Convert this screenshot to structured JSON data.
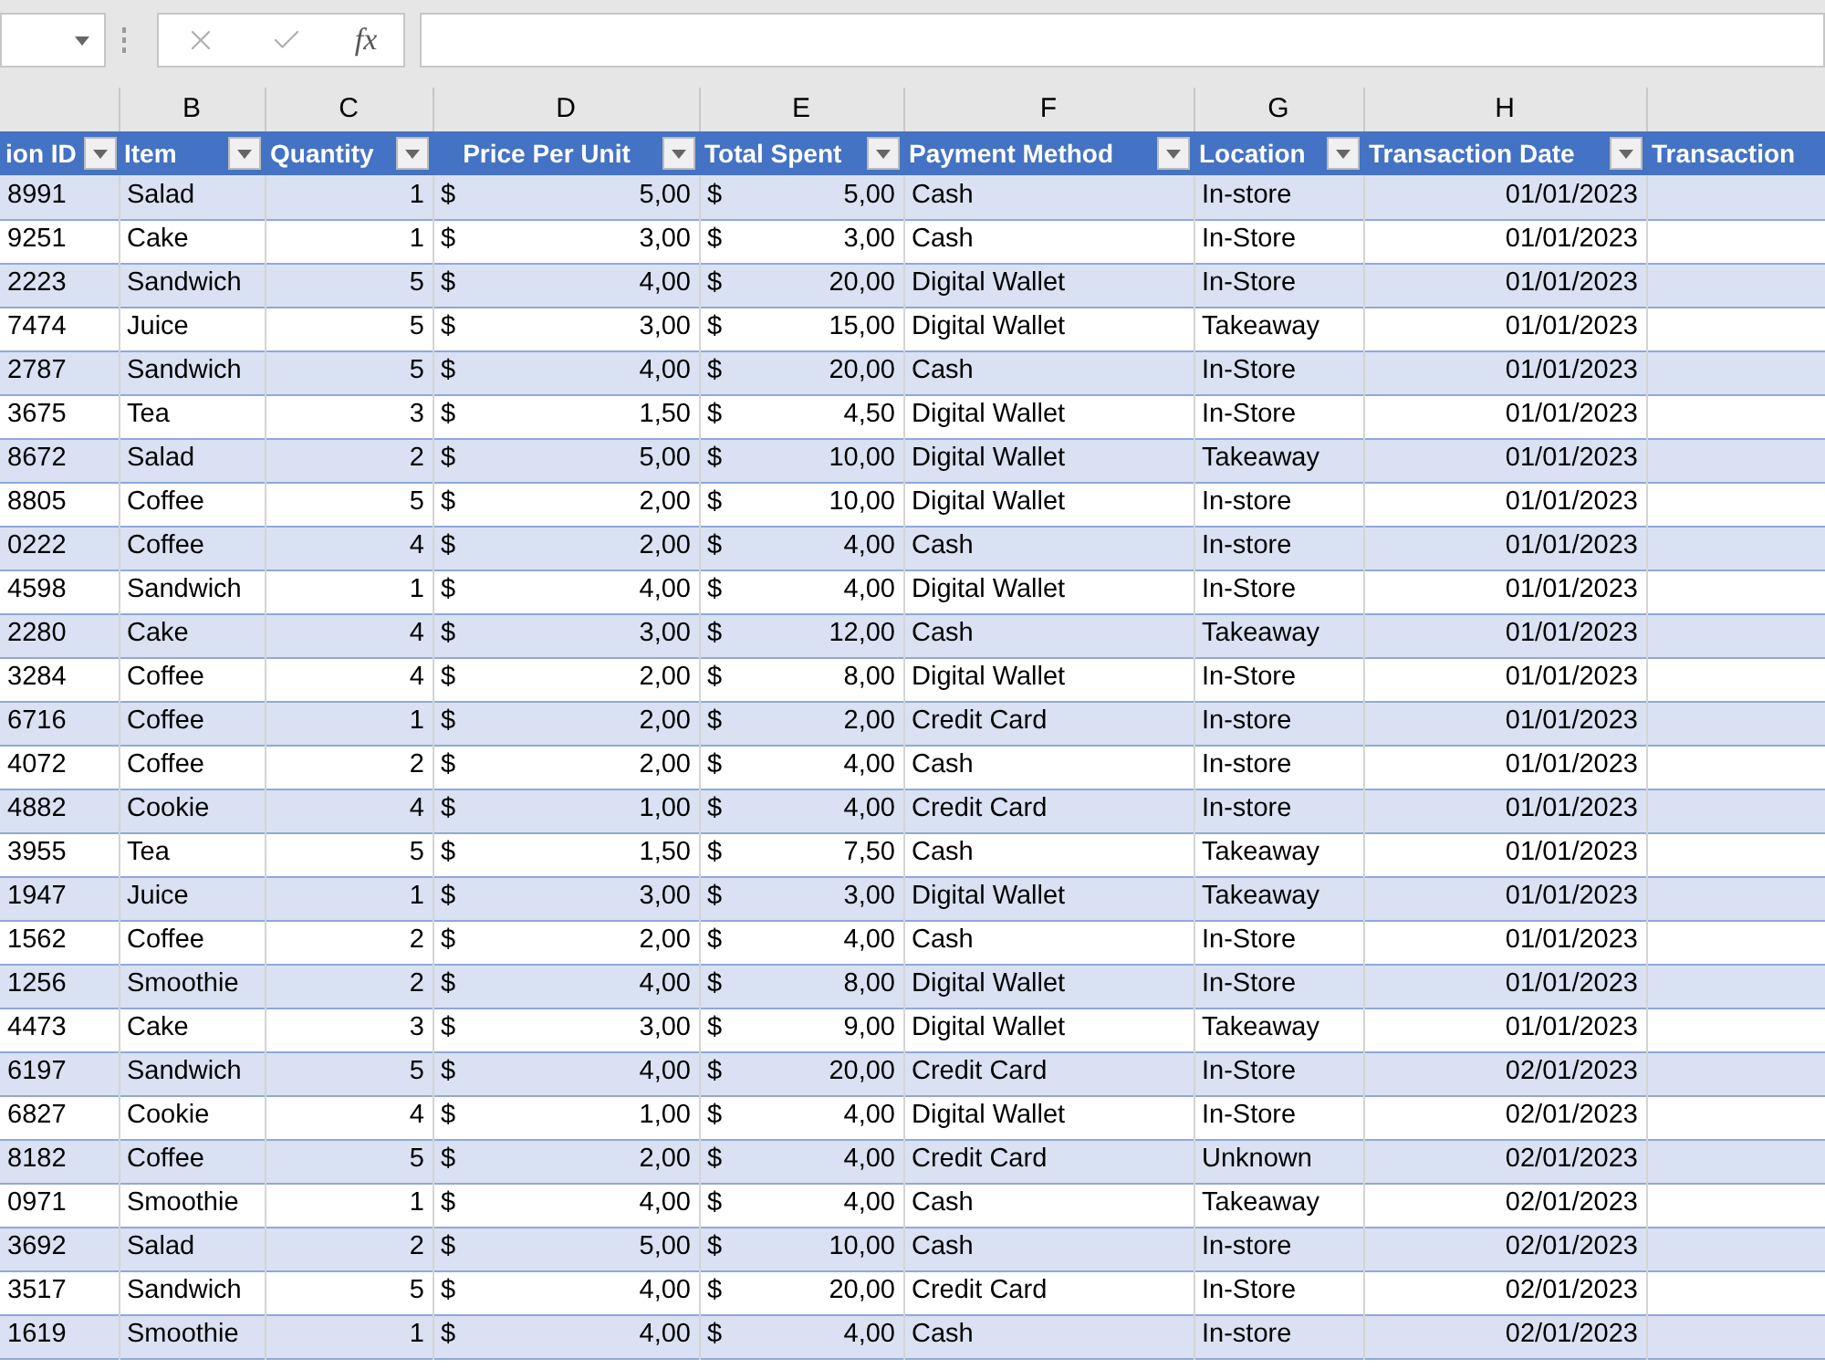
{
  "formula_bar": {
    "function_label": "fx"
  },
  "column_letters": [
    "B",
    "C",
    "D",
    "E",
    "F",
    "G",
    "H"
  ],
  "table": {
    "columns": [
      {
        "label": "ion ID",
        "filter": true
      },
      {
        "label": "Item",
        "filter": true
      },
      {
        "label": "Quantity",
        "filter": true
      },
      {
        "label": "Price Per Unit",
        "filter": true
      },
      {
        "label": "Total Spent",
        "filter": true
      },
      {
        "label": "Payment Method",
        "filter": true
      },
      {
        "label": "Location",
        "filter": true
      },
      {
        "label": "Transaction Date",
        "filter": true
      },
      {
        "label": "Transaction",
        "filter": false
      }
    ],
    "rows": [
      {
        "id": "8991",
        "item": "Salad",
        "quantity": "1",
        "price": {
          "currency": "$",
          "amount": "5,00"
        },
        "total": {
          "currency": "$",
          "amount": "5,00"
        },
        "payment": "Cash",
        "location": "In-store",
        "date": "01/01/2023"
      },
      {
        "id": "9251",
        "item": "Cake",
        "quantity": "1",
        "price": {
          "currency": "$",
          "amount": "3,00"
        },
        "total": {
          "currency": "$",
          "amount": "3,00"
        },
        "payment": "Cash",
        "location": "In-Store",
        "date": "01/01/2023"
      },
      {
        "id": "2223",
        "item": "Sandwich",
        "quantity": "5",
        "price": {
          "currency": "$",
          "amount": "4,00"
        },
        "total": {
          "currency": "$",
          "amount": "20,00"
        },
        "payment": "Digital Wallet",
        "location": "In-Store",
        "date": "01/01/2023"
      },
      {
        "id": "7474",
        "item": "Juice",
        "quantity": "5",
        "price": {
          "currency": "$",
          "amount": "3,00"
        },
        "total": {
          "currency": "$",
          "amount": "15,00"
        },
        "payment": "Digital Wallet",
        "location": "Takeaway",
        "date": "01/01/2023"
      },
      {
        "id": "2787",
        "item": "Sandwich",
        "quantity": "5",
        "price": {
          "currency": "$",
          "amount": "4,00"
        },
        "total": {
          "currency": "$",
          "amount": "20,00"
        },
        "payment": "Cash",
        "location": "In-Store",
        "date": "01/01/2023"
      },
      {
        "id": "3675",
        "item": "Tea",
        "quantity": "3",
        "price": {
          "currency": "$",
          "amount": "1,50"
        },
        "total": {
          "currency": "$",
          "amount": "4,50"
        },
        "payment": "Digital Wallet",
        "location": "In-Store",
        "date": "01/01/2023"
      },
      {
        "id": "8672",
        "item": "Salad",
        "quantity": "2",
        "price": {
          "currency": "$",
          "amount": "5,00"
        },
        "total": {
          "currency": "$",
          "amount": "10,00"
        },
        "payment": "Digital Wallet",
        "location": "Takeaway",
        "date": "01/01/2023"
      },
      {
        "id": "8805",
        "item": "Coffee",
        "quantity": "5",
        "price": {
          "currency": "$",
          "amount": "2,00"
        },
        "total": {
          "currency": "$",
          "amount": "10,00"
        },
        "payment": "Digital Wallet",
        "location": "In-store",
        "date": "01/01/2023"
      },
      {
        "id": "0222",
        "item": "Coffee",
        "quantity": "4",
        "price": {
          "currency": "$",
          "amount": "2,00"
        },
        "total": {
          "currency": "$",
          "amount": "4,00"
        },
        "payment": "Cash",
        "location": "In-store",
        "date": "01/01/2023"
      },
      {
        "id": "4598",
        "item": "Sandwich",
        "quantity": "1",
        "price": {
          "currency": "$",
          "amount": "4,00"
        },
        "total": {
          "currency": "$",
          "amount": "4,00"
        },
        "payment": "Digital Wallet",
        "location": "In-Store",
        "date": "01/01/2023"
      },
      {
        "id": "2280",
        "item": "Cake",
        "quantity": "4",
        "price": {
          "currency": "$",
          "amount": "3,00"
        },
        "total": {
          "currency": "$",
          "amount": "12,00"
        },
        "payment": "Cash",
        "location": "Takeaway",
        "date": "01/01/2023"
      },
      {
        "id": "3284",
        "item": "Coffee",
        "quantity": "4",
        "price": {
          "currency": "$",
          "amount": "2,00"
        },
        "total": {
          "currency": "$",
          "amount": "8,00"
        },
        "payment": "Digital Wallet",
        "location": "In-Store",
        "date": "01/01/2023"
      },
      {
        "id": "6716",
        "item": "Coffee",
        "quantity": "1",
        "price": {
          "currency": "$",
          "amount": "2,00"
        },
        "total": {
          "currency": "$",
          "amount": "2,00"
        },
        "payment": "Credit Card",
        "location": "In-store",
        "date": "01/01/2023"
      },
      {
        "id": "4072",
        "item": "Coffee",
        "quantity": "2",
        "price": {
          "currency": "$",
          "amount": "2,00"
        },
        "total": {
          "currency": "$",
          "amount": "4,00"
        },
        "payment": "Cash",
        "location": "In-store",
        "date": "01/01/2023"
      },
      {
        "id": "4882",
        "item": "Cookie",
        "quantity": "4",
        "price": {
          "currency": "$",
          "amount": "1,00"
        },
        "total": {
          "currency": "$",
          "amount": "4,00"
        },
        "payment": "Credit Card",
        "location": "In-store",
        "date": "01/01/2023"
      },
      {
        "id": "3955",
        "item": "Tea",
        "quantity": "5",
        "price": {
          "currency": "$",
          "amount": "1,50"
        },
        "total": {
          "currency": "$",
          "amount": "7,50"
        },
        "payment": "Cash",
        "location": "Takeaway",
        "date": "01/01/2023"
      },
      {
        "id": "1947",
        "item": "Juice",
        "quantity": "1",
        "price": {
          "currency": "$",
          "amount": "3,00"
        },
        "total": {
          "currency": "$",
          "amount": "3,00"
        },
        "payment": "Digital Wallet",
        "location": "Takeaway",
        "date": "01/01/2023"
      },
      {
        "id": "1562",
        "item": "Coffee",
        "quantity": "2",
        "price": {
          "currency": "$",
          "amount": "2,00"
        },
        "total": {
          "currency": "$",
          "amount": "4,00"
        },
        "payment": "Cash",
        "location": "In-Store",
        "date": "01/01/2023"
      },
      {
        "id": "1256",
        "item": "Smoothie",
        "quantity": "2",
        "price": {
          "currency": "$",
          "amount": "4,00"
        },
        "total": {
          "currency": "$",
          "amount": "8,00"
        },
        "payment": "Digital Wallet",
        "location": "In-Store",
        "date": "01/01/2023"
      },
      {
        "id": "4473",
        "item": "Cake",
        "quantity": "3",
        "price": {
          "currency": "$",
          "amount": "3,00"
        },
        "total": {
          "currency": "$",
          "amount": "9,00"
        },
        "payment": "Digital Wallet",
        "location": "Takeaway",
        "date": "01/01/2023"
      },
      {
        "id": "6197",
        "item": "Sandwich",
        "quantity": "5",
        "price": {
          "currency": "$",
          "amount": "4,00"
        },
        "total": {
          "currency": "$",
          "amount": "20,00"
        },
        "payment": "Credit Card",
        "location": "In-Store",
        "date": "02/01/2023"
      },
      {
        "id": "6827",
        "item": "Cookie",
        "quantity": "4",
        "price": {
          "currency": "$",
          "amount": "1,00"
        },
        "total": {
          "currency": "$",
          "amount": "4,00"
        },
        "payment": "Digital Wallet",
        "location": "In-Store",
        "date": "02/01/2023"
      },
      {
        "id": "8182",
        "item": "Coffee",
        "quantity": "5",
        "price": {
          "currency": "$",
          "amount": "2,00"
        },
        "total": {
          "currency": "$",
          "amount": "4,00"
        },
        "payment": "Credit Card",
        "location": "Unknown",
        "date": "02/01/2023"
      },
      {
        "id": "0971",
        "item": "Smoothie",
        "quantity": "1",
        "price": {
          "currency": "$",
          "amount": "4,00"
        },
        "total": {
          "currency": "$",
          "amount": "4,00"
        },
        "payment": "Cash",
        "location": "Takeaway",
        "date": "02/01/2023"
      },
      {
        "id": "3692",
        "item": "Salad",
        "quantity": "2",
        "price": {
          "currency": "$",
          "amount": "5,00"
        },
        "total": {
          "currency": "$",
          "amount": "10,00"
        },
        "payment": "Cash",
        "location": "In-store",
        "date": "02/01/2023"
      },
      {
        "id": "3517",
        "item": "Sandwich",
        "quantity": "5",
        "price": {
          "currency": "$",
          "amount": "4,00"
        },
        "total": {
          "currency": "$",
          "amount": "20,00"
        },
        "payment": "Credit Card",
        "location": "In-Store",
        "date": "02/01/2023"
      },
      {
        "id": "1619",
        "item": "Smoothie",
        "quantity": "1",
        "price": {
          "currency": "$",
          "amount": "4,00"
        },
        "total": {
          "currency": "$",
          "amount": "4,00"
        },
        "payment": "Cash",
        "location": "In-store",
        "date": "02/01/2023"
      }
    ]
  }
}
